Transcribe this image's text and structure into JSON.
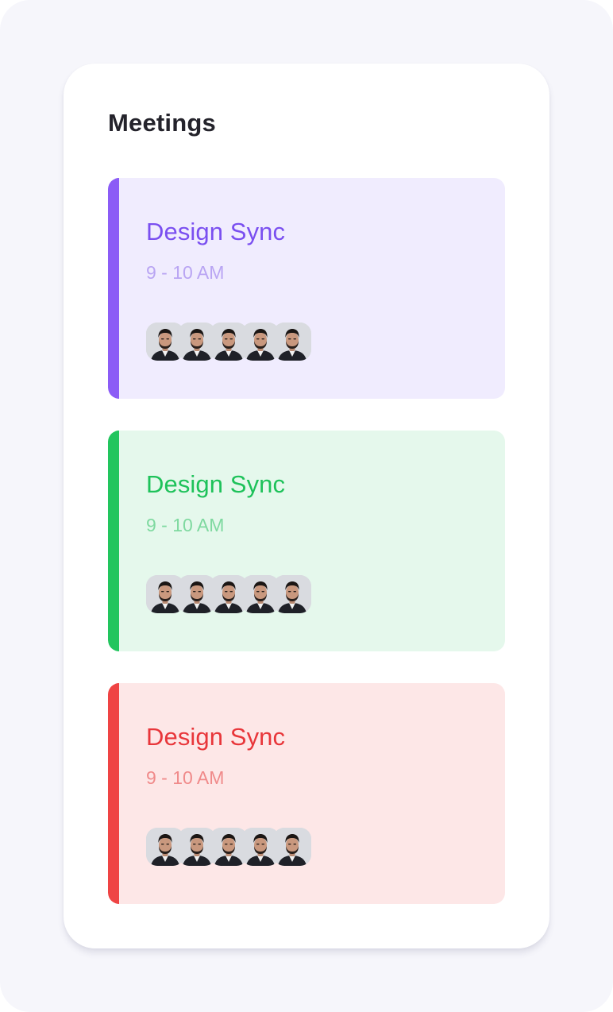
{
  "header": {
    "title": "Meetings"
  },
  "meetings": [
    {
      "title": "Design Sync",
      "time": "9 - 10 AM",
      "accent": "#8b5cf6",
      "title_color": "#7a4ff0",
      "time_color": "#b9a5f3",
      "background": "#f0ecfe",
      "attendee_count": 5
    },
    {
      "title": "Design Sync",
      "time": "9 - 10 AM",
      "accent": "#22c55e",
      "title_color": "#1ec25a",
      "time_color": "#7fd9a0",
      "background": "#e5f8ec",
      "attendee_count": 5
    },
    {
      "title": "Design Sync",
      "time": "9 - 10 AM",
      "accent": "#ef4444",
      "title_color": "#e8363a",
      "time_color": "#f08a8a",
      "background": "#fde7e7",
      "attendee_count": 5
    }
  ]
}
